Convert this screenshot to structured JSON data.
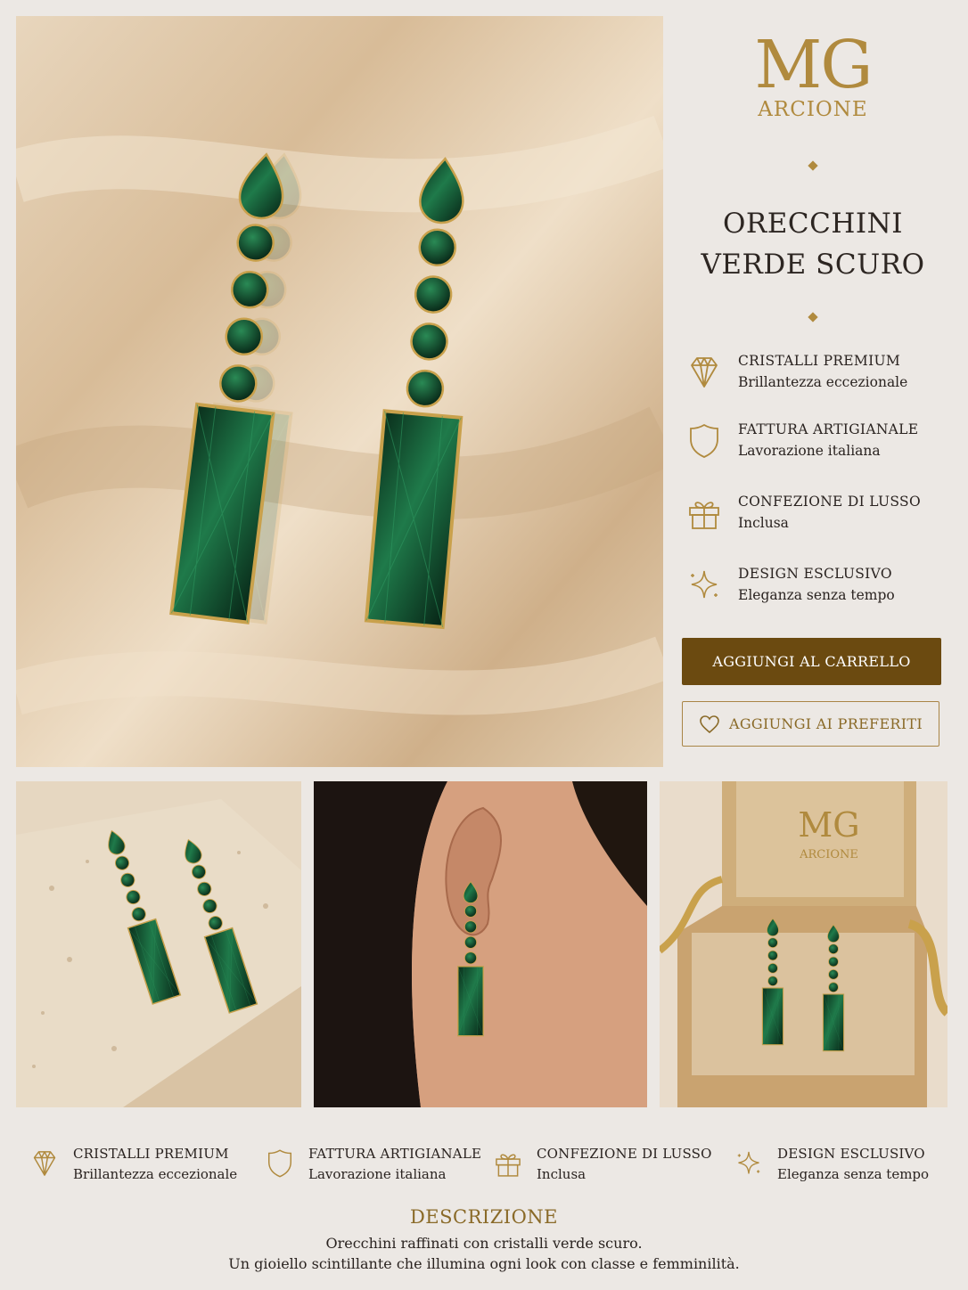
{
  "brand": {
    "logo_main": "MG",
    "logo_sub": "ARCIONE"
  },
  "product": {
    "title_line1": "ORECCHINI",
    "title_line2": "VERDE SCURO"
  },
  "features": [
    {
      "icon": "diamond-icon",
      "title": "CRISTALLI PREMIUM",
      "subtitle": "Brillantezza eccezionale"
    },
    {
      "icon": "shield-icon",
      "title": "FATTURA ARTIGIANALE",
      "subtitle": "Lavorazione italiana"
    },
    {
      "icon": "gift-icon",
      "title": "CONFEZIONE DI LUSSO",
      "subtitle": "Inclusa"
    },
    {
      "icon": "sparkle-icon",
      "title": "DESIGN ESCLUSIVO",
      "subtitle": "Eleganza senza tempo"
    }
  ],
  "actions": {
    "add_to_cart": "AGGIUNGI AL CARRELLO",
    "add_to_favorites": "AGGIUNGI AI PREFERITI"
  },
  "gallery": {
    "box_logo_main": "MG",
    "box_logo_sub": "ARCIONE"
  },
  "description": {
    "heading": "DESCRIZIONE",
    "line1": "Orecchini raffinati con cristalli verde scuro.",
    "line2": "Un gioiello scintillante che illumina ogni look con classe e femminilità."
  },
  "colors": {
    "gold": "#b08a3e",
    "button_brown": "#6b4a10",
    "emerald": "#0f4a2c",
    "background": "#ece8e4"
  }
}
